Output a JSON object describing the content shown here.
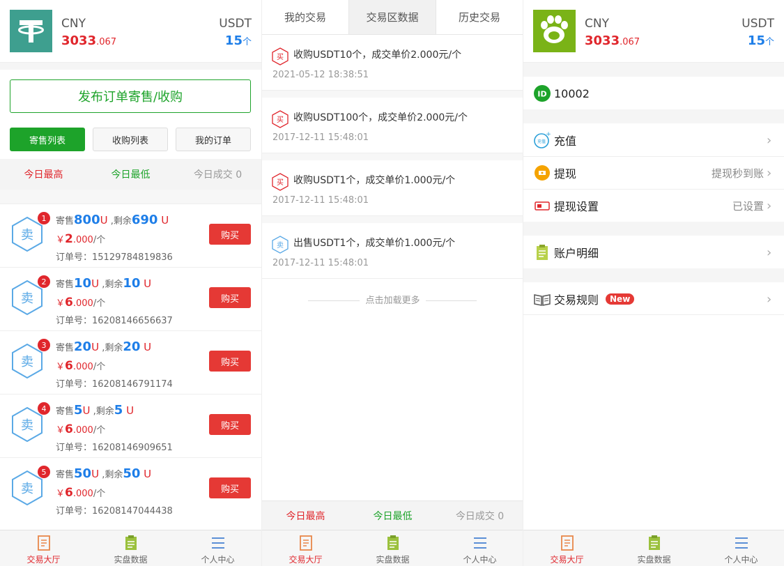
{
  "header": {
    "cny_label": "CNY",
    "cny_int": "3033",
    "cny_dec": ".067",
    "usdt_label": "USDT",
    "usdt_value": "15",
    "usdt_unit": "个"
  },
  "market": {
    "publish_label": "发布订单寄售/收购",
    "tabs": [
      "寄售列表",
      "收购列表",
      "我的订单"
    ],
    "stats": {
      "high": "今日最高",
      "low": "今日最低",
      "volume": "今日成交 0"
    },
    "orders": [
      {
        "rank": "1",
        "sell_label": "寄售",
        "amount": "800",
        "u": "U",
        "remain_label": " ,剩余",
        "remain": "690",
        "remain_u": " U",
        "price_int": "2",
        "price_dec": ".000",
        "per": "/个",
        "order_label": "订单号：",
        "order_no": "15129784819836",
        "buy": "购买"
      },
      {
        "rank": "2",
        "sell_label": "寄售",
        "amount": "10",
        "u": "U",
        "remain_label": " ,剩余",
        "remain": "10",
        "remain_u": " U",
        "price_int": "6",
        "price_dec": ".000",
        "per": "/个",
        "order_label": "订单号：",
        "order_no": "16208146656637",
        "buy": "购买"
      },
      {
        "rank": "3",
        "sell_label": "寄售",
        "amount": "20",
        "u": "U",
        "remain_label": " ,剩余",
        "remain": "20",
        "remain_u": " U",
        "price_int": "6",
        "price_dec": ".000",
        "per": "/个",
        "order_label": "订单号：",
        "order_no": "16208146791174",
        "buy": "购买"
      },
      {
        "rank": "4",
        "sell_label": "寄售",
        "amount": "5",
        "u": "U",
        "remain_label": " ,剩余",
        "remain": "5",
        "remain_u": " U",
        "price_int": "6",
        "price_dec": ".000",
        "per": "/个",
        "order_label": "订单号：",
        "order_no": "16208146909651",
        "buy": "购买"
      },
      {
        "rank": "5",
        "sell_label": "寄售",
        "amount": "50",
        "u": "U",
        "remain_label": " ,剩余",
        "remain": "50",
        "remain_u": " U",
        "price_int": "6",
        "price_dec": ".000",
        "per": "/个",
        "order_label": "订单号：",
        "order_no": "16208147044438",
        "buy": "购买"
      }
    ],
    "hex_glyph": "卖",
    "yen": "￥"
  },
  "trade_data": {
    "tabs": [
      "我的交易",
      "交易区数据",
      "历史交易"
    ],
    "records": [
      {
        "type": "买",
        "text": "收购USDT10个，成交单价2.000元/个",
        "date": "2021-05-12 18:38:51",
        "color": "#e0262c"
      },
      {
        "type": "买",
        "text": "收购USDT100个，成交单价2.000元/个",
        "date": "2017-12-11 15:48:01",
        "color": "#e0262c"
      },
      {
        "type": "买",
        "text": "收购USDT1个，成交单价1.000元/个",
        "date": "2017-12-11 15:48:01",
        "color": "#e0262c"
      },
      {
        "type": "卖",
        "text": "出售USDT1个，成交单价1.000元/个",
        "date": "2017-12-11 15:48:01",
        "color": "#5aa9e6"
      }
    ],
    "load_more": "点击加载更多",
    "stats": {
      "high": "今日最高",
      "low": "今日最低",
      "volume": "今日成交 0"
    }
  },
  "profile": {
    "user_id": "10002",
    "recharge": "充值",
    "recharge_icon_text": "充值",
    "withdraw": "提现",
    "withdraw_value": "提现秒到账",
    "withdraw_settings": "提现设置",
    "withdraw_settings_value": "已设置",
    "account_detail": "账户明细",
    "trade_rules": "交易规则",
    "new_badge": "New"
  },
  "nav": [
    "交易大厅",
    "实盘数据",
    "个人中心"
  ],
  "colors": {
    "red": "#e0262c",
    "green": "#1da32a",
    "blue": "#1e7ee8"
  }
}
